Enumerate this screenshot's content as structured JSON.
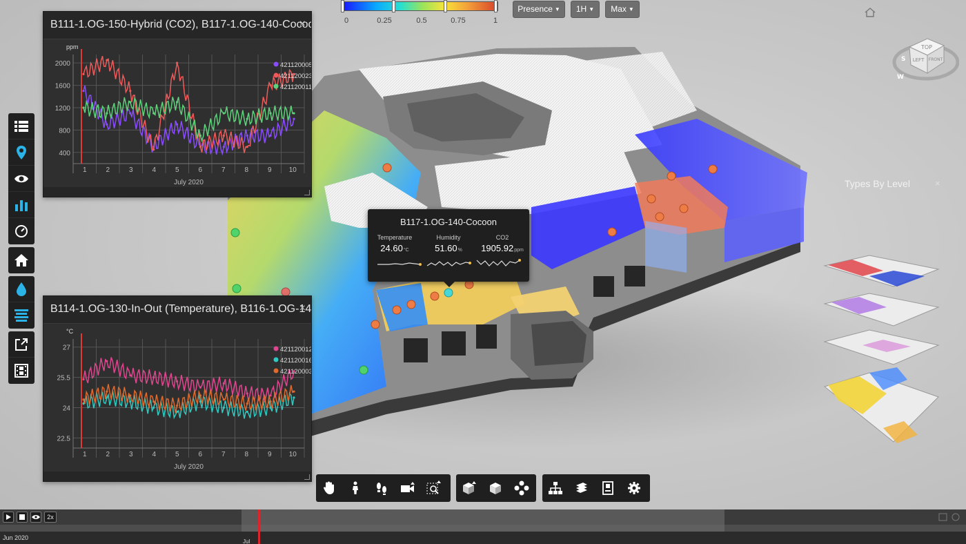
{
  "legend": {
    "ticks": [
      "0",
      "0.25",
      "0.5",
      "0.75",
      "1"
    ],
    "colors": [
      "#1a10ff",
      "#0aa8ff",
      "#27e0d0",
      "#9be35a",
      "#f7e33a",
      "#f4a43a",
      "#d7432b"
    ]
  },
  "toolbar_top": {
    "presence": "Presence",
    "interval": "1H",
    "aggregate": "Max"
  },
  "navcube": {
    "face_top": "TOP",
    "face_left": "LEFT",
    "face_front": "FRONT",
    "compass_s": "S",
    "compass_w": "W"
  },
  "left_toolbar": {
    "icons": [
      "list-icon",
      "map-pin-icon",
      "eye-icon",
      "bar-chart-icon",
      "gauge-icon",
      "home-icon",
      "water-drop-icon",
      "layers-icon",
      "share-icon",
      "film-icon"
    ]
  },
  "panel1": {
    "title": "B111-1.OG-150-Hybrid (CO2), B117-1.OG-140-Cocoon",
    "close": "×"
  },
  "panel2": {
    "title": "B114-1.OG-130-In-Out (Temperature), B116-1.OG-14…",
    "close": "×"
  },
  "chart_data": [
    {
      "type": "line",
      "ylabel": "ppm",
      "xlabel": "July 2020",
      "x": [
        1,
        2,
        3,
        4,
        5,
        6,
        7,
        8,
        9,
        10
      ],
      "xticks": [
        "1",
        "2",
        "3",
        "4",
        "5",
        "6",
        "7",
        "8",
        "9",
        "10"
      ],
      "yticks": [
        "400",
        "800",
        "1200",
        "1600",
        "2000"
      ],
      "ylim": [
        200,
        2150
      ],
      "grid": true,
      "legend_position": "top-right",
      "series": [
        {
          "name": "421120005",
          "color": "#8a4cff",
          "values": [
            1500,
            900,
            1100,
            500,
            900,
            500,
            500,
            700,
            700,
            1000
          ]
        },
        {
          "name": "421120023",
          "color": "#f05a5a",
          "values": [
            1800,
            2050,
            1500,
            450,
            2000,
            500,
            700,
            500,
            1600,
            1800
          ]
        },
        {
          "name": "421120011",
          "color": "#5dd27a",
          "values": [
            1200,
            1100,
            1300,
            1100,
            1300,
            700,
            1100,
            1000,
            1100,
            1100
          ]
        }
      ]
    },
    {
      "type": "line",
      "ylabel": "°C",
      "xlabel": "July 2020",
      "x": [
        1,
        2,
        3,
        4,
        5,
        6,
        7,
        8,
        9,
        10
      ],
      "xticks": [
        "1",
        "2",
        "3",
        "4",
        "5",
        "6",
        "7",
        "8",
        "9",
        "10"
      ],
      "yticks": [
        "22.5",
        "24",
        "25.5",
        "27"
      ],
      "ylim": [
        22,
        27.4
      ],
      "grid": true,
      "legend_position": "top-right",
      "series": [
        {
          "name": "421120012",
          "color": "#e0468f",
          "values": [
            25.4,
            26.3,
            25.6,
            25.5,
            25.3,
            25.0,
            25.2,
            24.7,
            24.6,
            25.8
          ]
        },
        {
          "name": "421120016",
          "color": "#2ec9c0",
          "values": [
            24.2,
            24.5,
            24.3,
            24.0,
            23.8,
            24.3,
            24.0,
            23.8,
            24.0,
            24.5
          ]
        },
        {
          "name": "421120003",
          "color": "#e0692c",
          "values": [
            24.4,
            24.8,
            24.6,
            24.3,
            24.1,
            24.6,
            24.4,
            24.2,
            24.3,
            24.8
          ]
        }
      ]
    }
  ],
  "tooltip": {
    "title": "B117-1.OG-140-Cocoon",
    "metrics": [
      {
        "label": "Temperature",
        "value": "24.60",
        "unit": "°C"
      },
      {
        "label": "Humidity",
        "value": "51.60",
        "unit": "%"
      },
      {
        "label": "CO2",
        "value": "1905.92",
        "unit": "ppm"
      }
    ]
  },
  "types_panel": {
    "title": "Types By Level",
    "close": "×"
  },
  "bottom_toolbar": {
    "group1": [
      "pan-hand-icon",
      "walk-icon",
      "footsteps-icon",
      "camera-icon",
      "zoom-window-icon"
    ],
    "group2": [
      "section-box-icon",
      "cube-icon",
      "explode-icon"
    ],
    "group3": [
      "model-tree-icon",
      "layers-stack-icon",
      "properties-icon",
      "settings-gear-icon"
    ]
  },
  "timeline": {
    "speed": "2x",
    "start_label": "Jun 2020",
    "tick_label": "Jul"
  }
}
